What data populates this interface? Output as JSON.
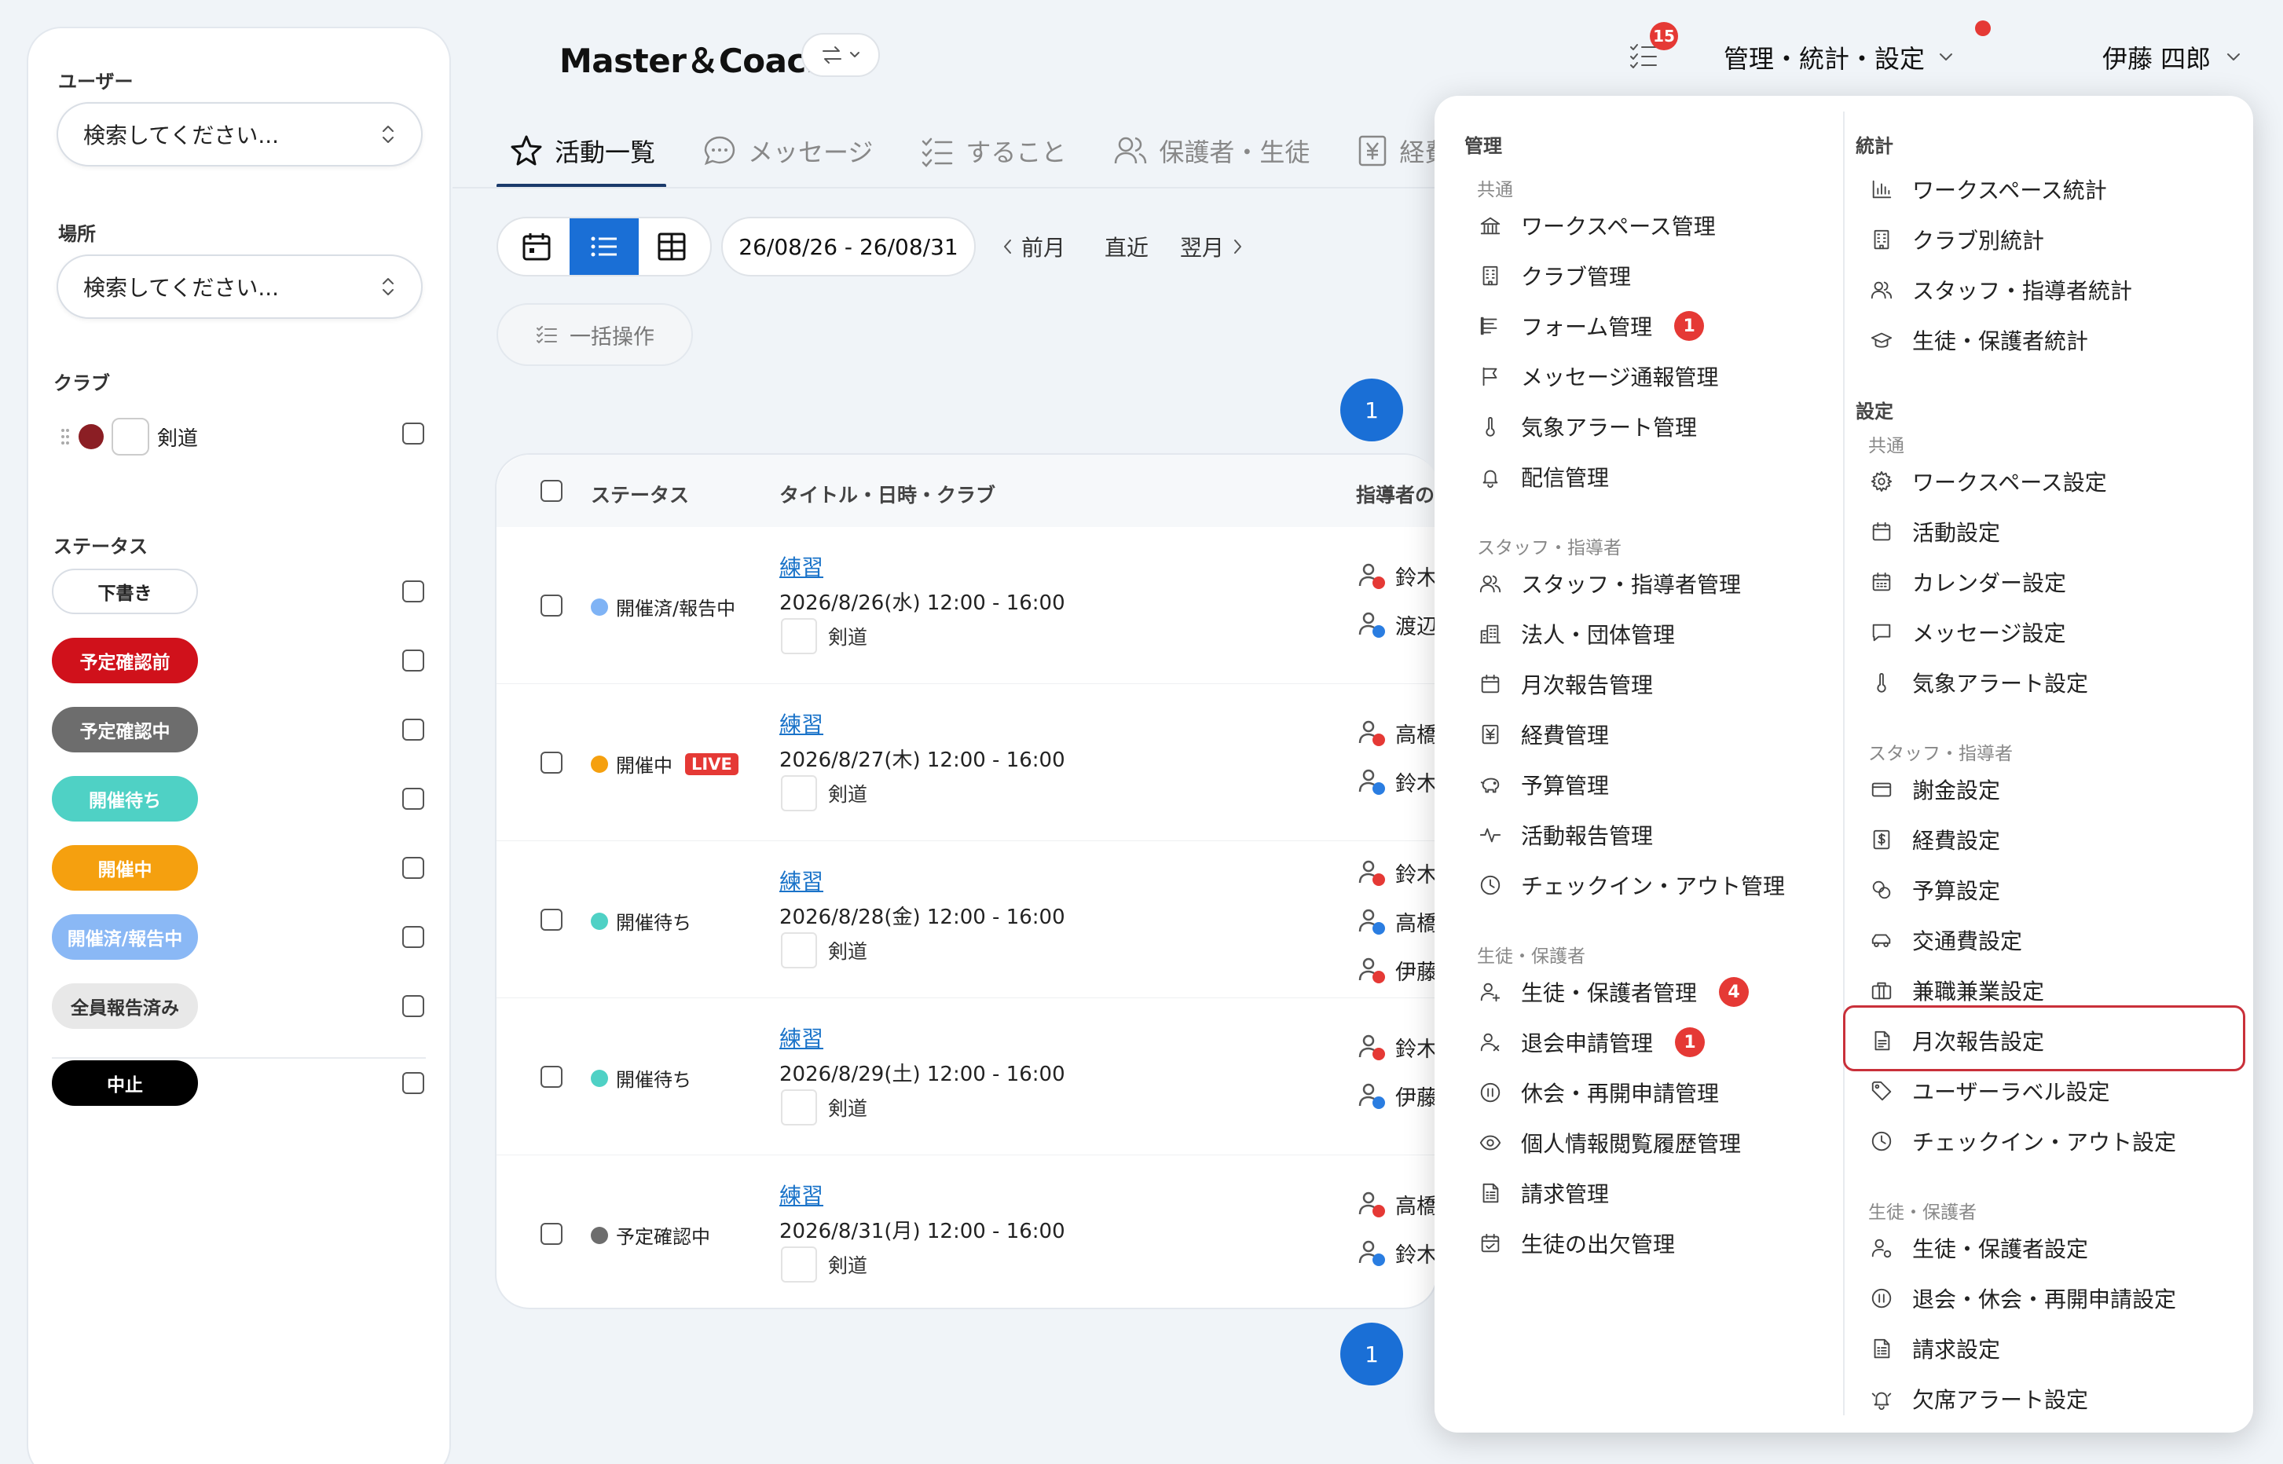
{
  "sidebar": {
    "user_label": "ユーザー",
    "user_placeholder": "検索してください...",
    "place_label": "場所",
    "place_placeholder": "検索してください...",
    "club_label": "クラブ",
    "club_name": "剣道",
    "club_color": "#8b1e24",
    "status_label": "ステータス",
    "statuses": [
      {
        "label": "下書き",
        "bg": "#ffffff",
        "fg": "#222222",
        "border": "#d9dee5"
      },
      {
        "label": "予定確認前",
        "bg": "#d0111b",
        "fg": "#ffffff",
        "border": "#d0111b"
      },
      {
        "label": "予定確認中",
        "bg": "#6d6d6d",
        "fg": "#ffffff",
        "border": "#6d6d6d"
      },
      {
        "label": "開催待ち",
        "bg": "#4fd1c5",
        "fg": "#ffffff",
        "border": "#4fd1c5"
      },
      {
        "label": "開催中",
        "bg": "#f5a00f",
        "fg": "#ffffff",
        "border": "#f5a00f"
      },
      {
        "label": "開催済/報告中",
        "bg": "#8ab8f5",
        "fg": "#ffffff",
        "border": "#8ab8f5"
      },
      {
        "label": "全員報告済み",
        "bg": "#e8e8e8",
        "fg": "#333333",
        "border": "#e8e8e8"
      },
      {
        "label": "中止",
        "bg": "#000000",
        "fg": "#ffffff",
        "border": "#000000"
      }
    ]
  },
  "header": {
    "app_title": "Master＆Coach",
    "task_badge": "15",
    "admin_menu": "管理・統計・設定",
    "user_name": "伊藤 四郎"
  },
  "tabs": [
    {
      "label": "活動一覧",
      "icon": "star-icon"
    },
    {
      "label": "メッセージ",
      "icon": "chat-icon"
    },
    {
      "label": "すること",
      "icon": "checklist-icon"
    },
    {
      "label": "保護者・生徒",
      "icon": "users-icon"
    },
    {
      "label": "経費",
      "icon": "yen-icon"
    }
  ],
  "toolbar": {
    "date_range": "26/08/26 - 26/08/31",
    "prev_month": "前月",
    "recent": "直近",
    "next_month": "翌月",
    "bulk_action": "一括操作",
    "page": "1"
  },
  "table": {
    "headers": {
      "status": "ステータス",
      "title": "タイトル・日時・クラブ",
      "coach": "指導者の出"
    },
    "rows": [
      {
        "status": "開催済/報告中",
        "dot": "#7fb3f5",
        "live": "",
        "title": "練習",
        "datetime": "2026/8/26(水) 12:00 - 16:00",
        "club": "剣道",
        "coaches": [
          "鈴木",
          "渡辺"
        ]
      },
      {
        "status": "開催中",
        "dot": "#f5a00f",
        "live": "LIVE",
        "title": "練習",
        "datetime": "2026/8/27(木) 12:00 - 16:00",
        "club": "剣道",
        "coaches": [
          "高橋",
          "鈴木"
        ]
      },
      {
        "status": "開催待ち",
        "dot": "#4fd1c5",
        "live": "",
        "title": "練習",
        "datetime": "2026/8/28(金) 12:00 - 16:00",
        "club": "剣道",
        "coaches": [
          "鈴木",
          "高橋",
          "伊藤"
        ]
      },
      {
        "status": "開催待ち",
        "dot": "#4fd1c5",
        "live": "",
        "title": "練習",
        "datetime": "2026/8/29(土) 12:00 - 16:00",
        "club": "剣道",
        "coaches": [
          "鈴木",
          "伊藤"
        ]
      },
      {
        "status": "予定確認中",
        "dot": "#6d6d6d",
        "live": "",
        "title": "練習",
        "datetime": "2026/8/31(月) 12:00 - 16:00",
        "club": "剣道",
        "coaches": [
          "高橋",
          "鈴木"
        ]
      }
    ]
  },
  "dropdown": {
    "left": {
      "title": "管理",
      "groups": [
        {
          "label": "共通",
          "items": [
            {
              "label": "ワークスペース管理",
              "icon": "bank-icon",
              "badge": ""
            },
            {
              "label": "クラブ管理",
              "icon": "building-icon",
              "badge": ""
            },
            {
              "label": "フォーム管理",
              "icon": "form-icon",
              "badge": "1"
            },
            {
              "label": "メッセージ通報管理",
              "icon": "flag-icon",
              "badge": ""
            },
            {
              "label": "気象アラート管理",
              "icon": "thermometer-icon",
              "badge": ""
            },
            {
              "label": "配信管理",
              "icon": "bell-icon",
              "badge": ""
            }
          ]
        },
        {
          "label": "スタッフ・指導者",
          "items": [
            {
              "label": "スタッフ・指導者管理",
              "icon": "users-icon",
              "badge": ""
            },
            {
              "label": "法人・団体管理",
              "icon": "office-icon",
              "badge": ""
            },
            {
              "label": "月次報告管理",
              "icon": "calendar-icon",
              "badge": ""
            },
            {
              "label": "経費管理",
              "icon": "yen-icon",
              "badge": ""
            },
            {
              "label": "予算管理",
              "icon": "piggy-bank-icon",
              "badge": ""
            },
            {
              "label": "活動報告管理",
              "icon": "activity-icon",
              "badge": ""
            },
            {
              "label": "チェックイン・アウト管理",
              "icon": "clock-icon",
              "badge": ""
            }
          ]
        },
        {
          "label": "生徒・保護者",
          "items": [
            {
              "label": "生徒・保護者管理",
              "icon": "user-plus-icon",
              "badge": "4"
            },
            {
              "label": "退会申請管理",
              "icon": "user-x-icon",
              "badge": "1"
            },
            {
              "label": "休会・再開申請管理",
              "icon": "pause-circle-icon",
              "badge": ""
            },
            {
              "label": "個人情報閲覧履歴管理",
              "icon": "eye-icon",
              "badge": ""
            },
            {
              "label": "請求管理",
              "icon": "invoice-icon",
              "badge": ""
            },
            {
              "label": "生徒の出欠管理",
              "icon": "calendar-check-icon",
              "badge": ""
            }
          ]
        }
      ]
    },
    "right": {
      "stats_title": "統計",
      "stats_items": [
        {
          "label": "ワークスペース統計",
          "icon": "bar-chart-icon"
        },
        {
          "label": "クラブ別統計",
          "icon": "building-icon"
        },
        {
          "label": "スタッフ・指導者統計",
          "icon": "users-icon"
        },
        {
          "label": "生徒・保護者統計",
          "icon": "graduation-cap-icon"
        }
      ],
      "settings_title": "設定",
      "groups": [
        {
          "label": "共通",
          "items": [
            {
              "label": "ワークスペース設定",
              "icon": "gear-icon"
            },
            {
              "label": "活動設定",
              "icon": "calendar-icon"
            },
            {
              "label": "カレンダー設定",
              "icon": "calendar-grid-icon"
            },
            {
              "label": "メッセージ設定",
              "icon": "message-square-icon"
            },
            {
              "label": "気象アラート設定",
              "icon": "thermometer-icon"
            }
          ]
        },
        {
          "label": "スタッフ・指導者",
          "items": [
            {
              "label": "謝金設定",
              "icon": "card-icon"
            },
            {
              "label": "経費設定",
              "icon": "dollar-doc-icon"
            },
            {
              "label": "予算設定",
              "icon": "coins-icon"
            },
            {
              "label": "交通費設定",
              "icon": "car-icon"
            },
            {
              "label": "兼職兼業設定",
              "icon": "briefcase-icon"
            },
            {
              "label": "月次報告設定",
              "icon": "document-icon",
              "highlight": true
            },
            {
              "label": "ユーザーラベル設定",
              "icon": "tag-icon"
            },
            {
              "label": "チェックイン・アウト設定",
              "icon": "clock-icon"
            }
          ]
        },
        {
          "label": "生徒・保護者",
          "items": [
            {
              "label": "生徒・保護者設定",
              "icon": "user-gear-icon"
            },
            {
              "label": "退会・休会・再開申請設定",
              "icon": "pause-circle-icon"
            },
            {
              "label": "請求設定",
              "icon": "invoice-icon"
            },
            {
              "label": "欠席アラート設定",
              "icon": "bell-alert-icon"
            }
          ]
        }
      ]
    }
  },
  "colors": {
    "accent": "#1a6fd6",
    "highlight_border": "#c9303a",
    "badge": "#e53935"
  }
}
